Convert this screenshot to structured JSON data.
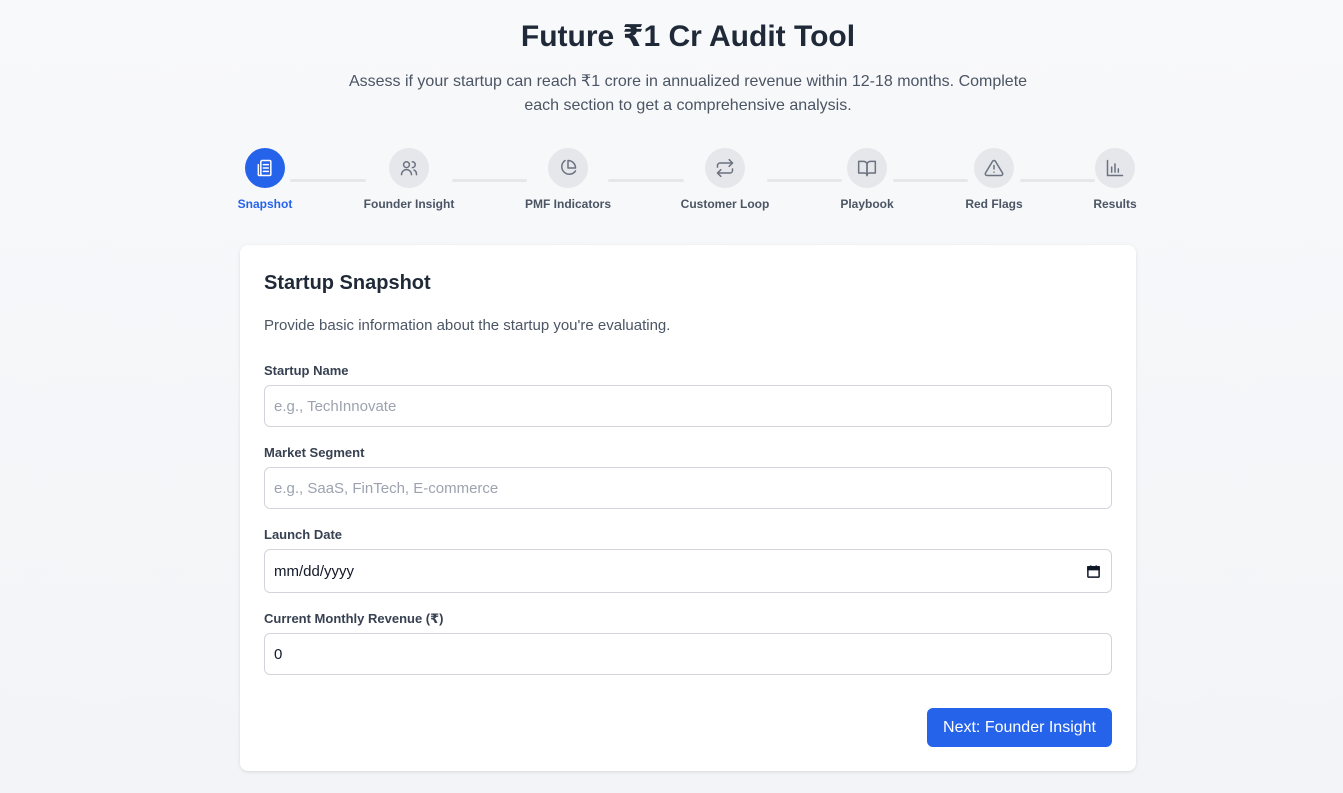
{
  "header": {
    "title": "Future ₹1 Cr Audit Tool",
    "subtitle": "Assess if your startup can reach ₹1 crore in annualized revenue within 12-18 months. Complete each section to get a comprehensive analysis."
  },
  "steps": [
    {
      "label": "Snapshot",
      "icon": "document-icon",
      "active": true
    },
    {
      "label": "Founder Insight",
      "icon": "users-icon",
      "active": false
    },
    {
      "label": "PMF Indicators",
      "icon": "pie-chart-icon",
      "active": false
    },
    {
      "label": "Customer Loop",
      "icon": "repeat-icon",
      "active": false
    },
    {
      "label": "Playbook",
      "icon": "book-icon",
      "active": false
    },
    {
      "label": "Red Flags",
      "icon": "warning-icon",
      "active": false
    },
    {
      "label": "Results",
      "icon": "bar-chart-icon",
      "active": false
    }
  ],
  "form": {
    "title": "Startup Snapshot",
    "description": "Provide basic information about the startup you're evaluating.",
    "startup_name": {
      "label": "Startup Name",
      "placeholder": "e.g., TechInnovate",
      "value": ""
    },
    "market_segment": {
      "label": "Market Segment",
      "placeholder": "e.g., SaaS, FinTech, E-commerce",
      "value": ""
    },
    "launch_date": {
      "label": "Launch Date",
      "value": "mm/dd/yyyy"
    },
    "monthly_revenue": {
      "label": "Current Monthly Revenue (₹)",
      "value": "0"
    },
    "next_button": "Next: Founder Insight"
  },
  "colors": {
    "accent": "#2563eb",
    "inactive_step": "#e5e7eb",
    "background": "#f5f6f8"
  }
}
